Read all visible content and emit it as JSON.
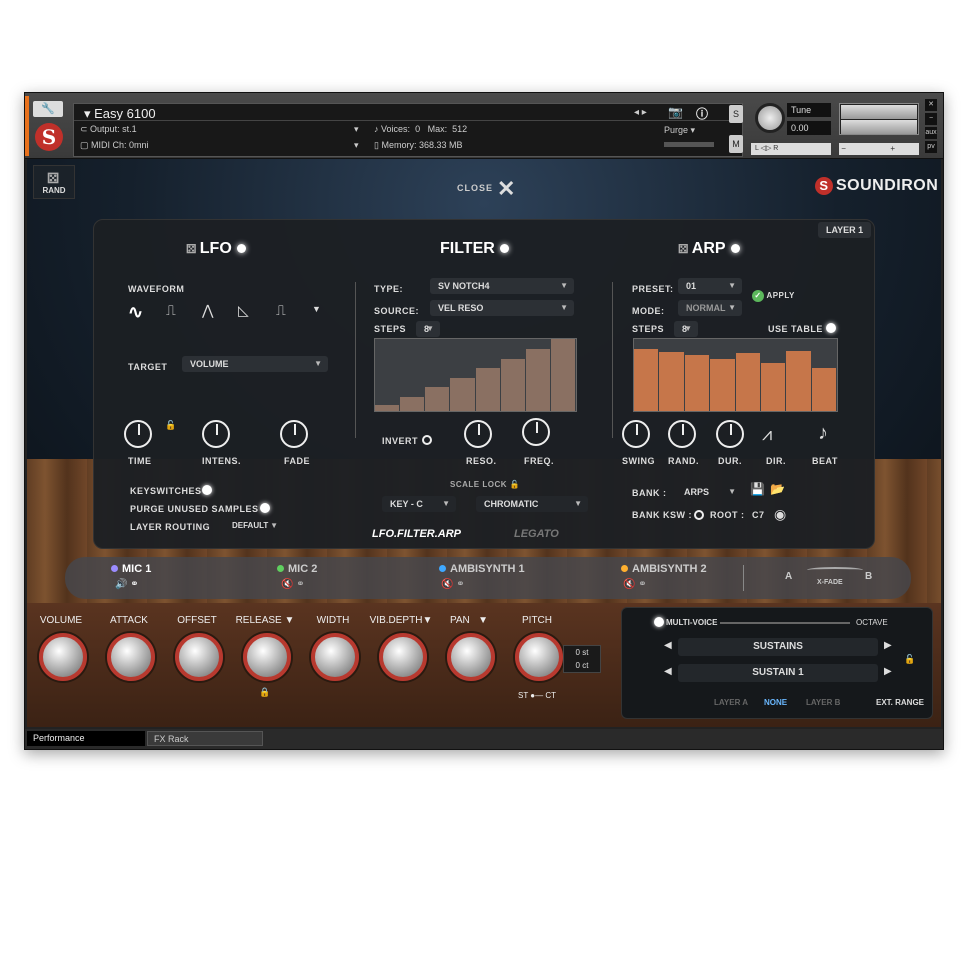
{
  "header": {
    "instrument": "Easy 6100",
    "output_label": "Output:",
    "output": "st.1",
    "midi_label": "MIDI Ch:",
    "midi": "0mni",
    "voices_label": "Voices:",
    "voices": "0",
    "max_label": "Max:",
    "max": "512",
    "memory_label": "Memory:",
    "memory": "368.33 MB",
    "purge": "Purge",
    "tune_label": "Tune",
    "tune_value": "0.00",
    "s": "S",
    "m": "M",
    "lr": "L   ◁▷   R"
  },
  "top": {
    "rand": "RAND",
    "close": "CLOSE",
    "brand": "SOUNDIRON",
    "layer": "LAYER 1"
  },
  "lfo": {
    "title": "LFO",
    "waveform": "WAVEFORM",
    "target_label": "TARGET",
    "target": "VOLUME",
    "knobs": [
      "TIME",
      "INTENS.",
      "FADE"
    ],
    "keyswitches": "KEYSWITCHES",
    "purge_unused": "PURGE UNUSED SAMPLES",
    "layer_routing": "LAYER ROUTING",
    "layer_routing_value": "DEFAULT"
  },
  "filter": {
    "title": "FILTER",
    "type_label": "TYPE:",
    "type": "SV NOTCH4",
    "source_label": "SOURCE:",
    "source": "VEL RESO",
    "steps_label": "STEPS",
    "steps": "8",
    "invert": "INVERT",
    "knobs": [
      "RESO.",
      "FREQ."
    ],
    "scale_lock": "SCALE LOCK",
    "key": "KEY - C",
    "scale": "CHROMATIC",
    "step_levels": [
      0.08,
      0.2,
      0.33,
      0.46,
      0.6,
      0.72,
      0.86,
      1.0
    ]
  },
  "arp": {
    "title": "ARP",
    "preset_label": "PRESET:",
    "preset": "01",
    "apply": "APPLY",
    "mode_label": "MODE:",
    "mode": "NORMAL",
    "steps_label": "STEPS",
    "steps": "8",
    "use_table": "USE TABLE",
    "knobs": [
      "SWING",
      "RAND.",
      "DUR.",
      "DIR.",
      "BEAT"
    ],
    "bank_label": "BANK :",
    "bank": "ARPS",
    "bank_ksw": "BANK KSW :",
    "root_label": "ROOT :",
    "root": "C7",
    "step_levels": [
      0.86,
      0.82,
      0.78,
      0.72,
      0.8,
      0.66,
      0.84,
      0.6
    ]
  },
  "tabs": {
    "active": "LFO.FILTER.ARP",
    "other": "LEGATO"
  },
  "mics": [
    {
      "name": "MIC 1",
      "color": "#9b8cff"
    },
    {
      "name": "MIC 2",
      "color": "#5fcf5f"
    },
    {
      "name": "AMBISYNTH 1",
      "color": "#3fa8ff"
    },
    {
      "name": "AMBISYNTH 2",
      "color": "#ffb02f"
    }
  ],
  "xfade": {
    "a": "A",
    "b": "B",
    "label": "X-FADE"
  },
  "controls": [
    "VOLUME",
    "ATTACK",
    "OFFSET",
    "RELEASE",
    "WIDTH",
    "VIB.DEPTH",
    "PAN",
    "PITCH"
  ],
  "pitch": {
    "st": "0 st",
    "ct": "0 ct",
    "st_label": "ST",
    "ct_label": "CT"
  },
  "right": {
    "multi_voice": "MULTI-VOICE",
    "octave": "OCTAVE",
    "articulation": "SUSTAINS",
    "variant": "SUSTAIN 1",
    "layer_a": "LAYER A",
    "none": "NONE",
    "layer_b": "LAYER B",
    "ext_range": "EXT. RANGE"
  },
  "bottom_tabs": {
    "performance": "Performance",
    "fx_rack": "FX Rack"
  }
}
